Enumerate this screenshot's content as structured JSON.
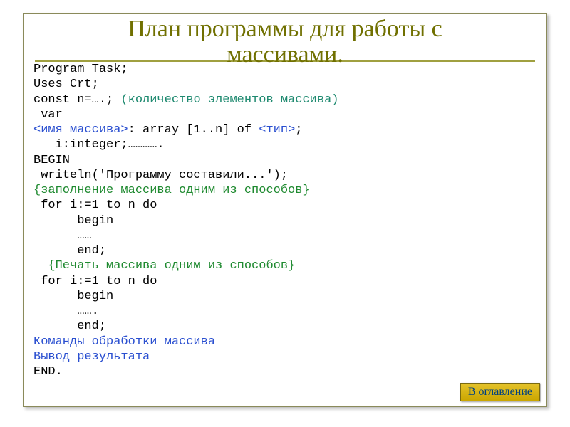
{
  "title_line1": "План программы для работы с",
  "title_line2": "массивами.",
  "code": {
    "l1": "Program Task;",
    "l2": "Uses Crt;",
    "l3a": "const n=….; ",
    "l3b": "(количество элементов массива)",
    "l4": " var",
    "l5a": "<имя массива>",
    "l5b": ": array [1..n] of ",
    "l5c": "<тип>",
    "l5d": ";",
    "l6": "   i:integer;………….",
    "l7": "BEGIN",
    "l8": " writeln('Программу составили...');",
    "l9": "{заполнение массива одним из способов}",
    "l10": " for i:=1 to n do",
    "l11": "      begin",
    "l12": "      ……",
    "l13": "      end;",
    "l14": "  {Печать массива одним из способов}",
    "l15": " for i:=1 to n do",
    "l16": "      begin",
    "l17": "      …….",
    "l18": "      end;",
    "l19": "Команды обработки массива",
    "l20": "Вывод результата",
    "l21": "END."
  },
  "toc_label": "В оглавление"
}
